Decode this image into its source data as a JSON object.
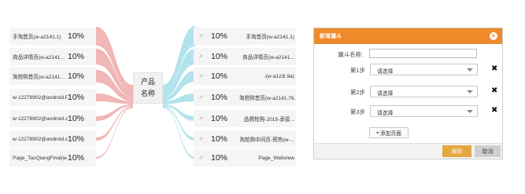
{
  "sankey": {
    "center": {
      "line1": "产品",
      "line2": "名称"
    },
    "left_items": [
      {
        "label": "手淘首页(w-a2141.1)",
        "pct": "10%"
      },
      {
        "label": "商品详情页(w-a2141...",
        "pct": "10%"
      },
      {
        "label": "淘抢购首页(w-a2141...",
        "pct": "10%"
      },
      {
        "label": "w-12278902@android.P",
        "pct": "10%"
      },
      {
        "label": "w-12278902@android.c...",
        "pct": "10%"
      },
      {
        "label": "w-12278902@android.c...",
        "pct": "10%"
      },
      {
        "label": "Page_TaoQiangFinal(w-...",
        "pct": "10%"
      }
    ],
    "right_items": [
      {
        "label": "手淘首页(w-a2141.1)",
        "pct": "10%"
      },
      {
        "label": "商品详情页(w-a2141...",
        "pct": "10%"
      },
      {
        "label": "-(w-a1z3i.9a)",
        "pct": "10%"
      },
      {
        "label": "淘抢购首页(w-a2141.76...",
        "pct": "10%"
      },
      {
        "label": "品牌抢购-2015-承接...",
        "pct": "10%"
      },
      {
        "label": "淘抢购中间页-预热(w-...",
        "pct": "10%"
      },
      {
        "label": "Page_Webview",
        "pct": "10%"
      }
    ],
    "colors": {
      "left_flow": "#e88585",
      "right_flow": "#7fd0e0",
      "arrow_icon": "#aaaaaa"
    }
  },
  "dialog": {
    "title": "新增漏斗",
    "close_icon": "×",
    "name_label": "漏斗名称:",
    "name_value": "",
    "steps": [
      {
        "label": "第1步",
        "value": "请选择",
        "remove": "✖"
      },
      {
        "label": "第2步",
        "value": "请选择",
        "remove": "✖"
      },
      {
        "label": "第3步",
        "value": "请选择",
        "remove": "✖"
      }
    ],
    "add_page": "添加页面",
    "add_plus": "+",
    "save": "保存",
    "cancel": "取消",
    "colors": {
      "header": "#ef8a2a",
      "save": "#e4a842",
      "cancel": "#cfcfcf"
    }
  }
}
